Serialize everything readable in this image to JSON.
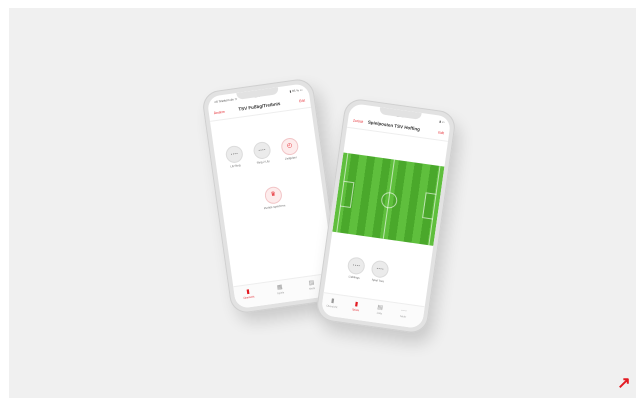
{
  "colors": {
    "accent": "#e31b23",
    "panel_bg": "#f0f0f0",
    "pitch": "#4aa82b"
  },
  "left_phone": {
    "status": {
      "carrier": "••ll Telekom.de ᯤ",
      "time": "13:48",
      "battery": "▮ 65 % ▭"
    },
    "nav": {
      "back": "Ändern",
      "title": "TSV Fußbg/Treibnis",
      "edit": "Edit"
    },
    "buttons": [
      {
        "icon": "ring-icon",
        "text": "• • •\n•",
        "label": "Lili Ring"
      },
      {
        "icon": "ring-icon",
        "text": "• • •\n•",
        "label": "Ring 2 Lily"
      },
      {
        "icon": "clock-icon",
        "text": "◴",
        "label": "Zeitgeber"
      }
    ],
    "center_button": {
      "icon": "trophy-icon",
      "text": "♛",
      "label": "Punkte speichern"
    },
    "tabs": [
      {
        "icon": "home-icon",
        "label": "Übersicht",
        "glyph": "▮"
      },
      {
        "icon": "grid-icon",
        "label": "Spiele",
        "glyph": "▦"
      },
      {
        "icon": "list-icon",
        "label": "Mehr",
        "glyph": "▤"
      }
    ]
  },
  "right_phone": {
    "status": {
      "time": "13:48",
      "battery": "▮ ▭"
    },
    "nav": {
      "back": "Zurück",
      "title": "Spielposten TSV Hoffing",
      "edit": "Edit"
    },
    "buttons": [
      {
        "icon": "ring-icon",
        "text": "• • •\n•",
        "label": "Lieblings"
      },
      {
        "icon": "ring-icon",
        "text": "• • •\n•",
        "label": "Spiel Tore"
      }
    ],
    "tabs": [
      {
        "icon": "home-icon",
        "label": "Übersicht",
        "glyph": "▮"
      },
      {
        "icon": "pin-icon",
        "label": "Spiele",
        "glyph": "▮"
      },
      {
        "icon": "list-icon",
        "label": "Liste",
        "glyph": "▤"
      },
      {
        "icon": "more-icon",
        "label": "Mehr",
        "glyph": "⋯"
      }
    ]
  },
  "corner": {
    "icon": "arrow-up-right-icon",
    "glyph": "↗"
  }
}
